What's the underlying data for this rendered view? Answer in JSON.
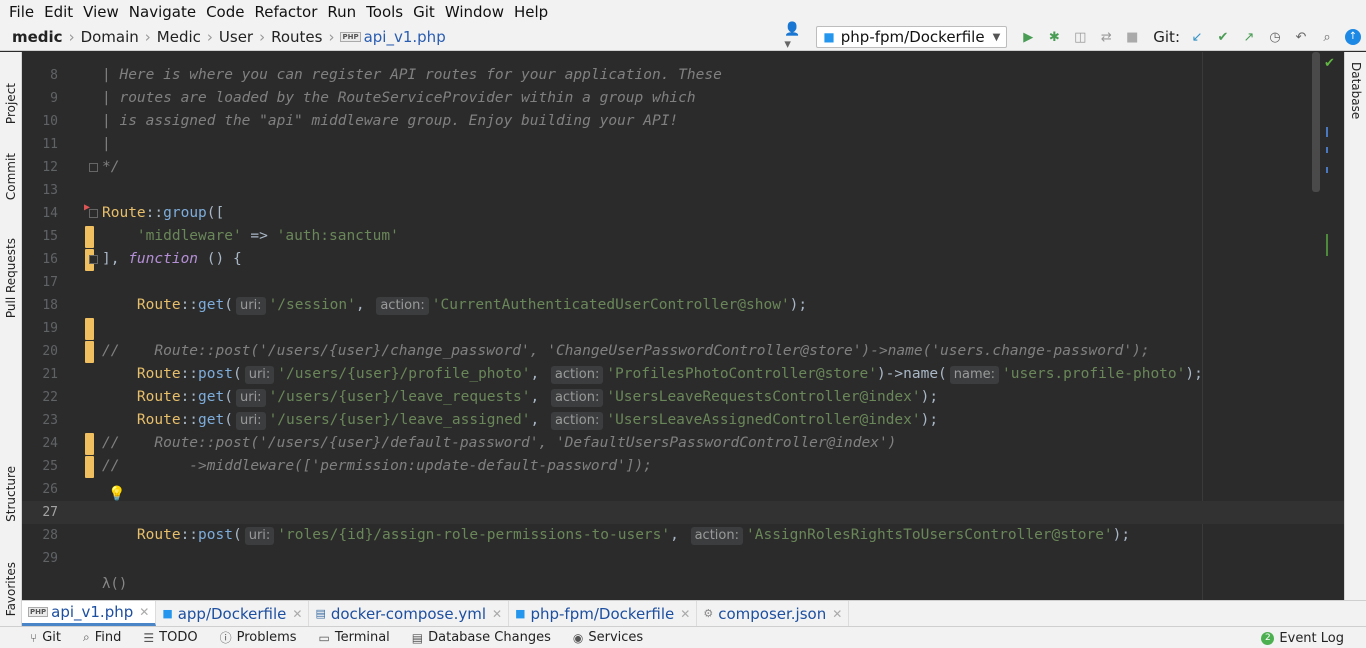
{
  "menu": [
    "File",
    "Edit",
    "View",
    "Navigate",
    "Code",
    "Refactor",
    "Run",
    "Tools",
    "Git",
    "Window",
    "Help"
  ],
  "breadcrumb": {
    "project": "medic",
    "items": [
      "Domain",
      "Medic",
      "User",
      "Routes"
    ],
    "file": "api_v1.php",
    "file_type": "PHP"
  },
  "toolbar": {
    "run_config": "php-fpm/Dockerfile",
    "git_label": "Git:"
  },
  "left_tabs": {
    "project": "Project",
    "commit": "Commit",
    "pull_requests": "Pull Requests",
    "structure": "Structure",
    "favorites": "Favorites"
  },
  "right_tabs": {
    "database": "Database"
  },
  "editor": {
    "lines": [
      {
        "n": "8",
        "t": "| Here is where you can register API routes for your application. These"
      },
      {
        "n": "9",
        "t": "| routes are loaded by the RouteServiceProvider within a group which"
      },
      {
        "n": "10",
        "t": "| is assigned the \"api\" middleware group. Enjoy building your API!"
      },
      {
        "n": "11",
        "t": "|"
      },
      {
        "n": "12",
        "t": "*/"
      },
      {
        "n": "13"
      },
      {
        "n": "14"
      },
      {
        "n": "15"
      },
      {
        "n": "16"
      },
      {
        "n": "17"
      },
      {
        "n": "18"
      },
      {
        "n": "19"
      },
      {
        "n": "20",
        "t": "//    Route::post('/users/{user}/change_password', 'ChangeUserPasswordController@store')->name('users.change-password');"
      },
      {
        "n": "21"
      },
      {
        "n": "22"
      },
      {
        "n": "23"
      },
      {
        "n": "24",
        "t": "//    Route::post('/users/{user}/default-password', 'DefaultUsersPasswordController@index')"
      },
      {
        "n": "25",
        "t": "//        ->middleware(['permission:update-default-password']);"
      },
      {
        "n": "26"
      },
      {
        "n": "27"
      },
      {
        "n": "28"
      },
      {
        "n": "29"
      }
    ],
    "tokens": {
      "route": "Route",
      "dc": "::",
      "group": "group",
      "open_group": "([",
      "middleware_key": "'middleware'",
      "arrow": " => ",
      "auth": "'auth:sanctum'",
      "close": "], ",
      "function": "function",
      "fn_rest": " () {",
      "get": "get",
      "post": "post",
      "paren": "(",
      "uri_hint": "uri:",
      "action_hint": "action:",
      "name_hint": "name:",
      "session_uri": "'/session'",
      "session_action": "'CurrentAuthenticatedUserController@show'",
      "photo_uri": "'/users/{user}/profile_photo'",
      "photo_action": "'ProfilesPhotoController@store'",
      "name_call": ")->name(",
      "photo_name": "'users.profile-photo'",
      "lreq_uri": "'/users/{user}/leave_requests'",
      "lreq_action": "'UsersLeaveRequestsController@index'",
      "lasg_uri": "'/users/{user}/leave_assigned'",
      "lasg_action": "'UsersLeaveAssignedController@index'",
      "roles_uri": "'roles/{id}/assign-role-permissions-to-users'",
      "roles_action": "'AssignRolesRightsToUsersController@store'",
      "end": ");",
      "comma": ", "
    },
    "lambda": "λ()"
  },
  "tabs": [
    {
      "label": "api_v1.php",
      "active": true
    },
    {
      "label": "app/Dockerfile"
    },
    {
      "label": "docker-compose.yml"
    },
    {
      "label": "php-fpm/Dockerfile"
    },
    {
      "label": "composer.json"
    }
  ],
  "status": {
    "git": "Git",
    "find": "Find",
    "todo": "TODO",
    "problems": "Problems",
    "terminal": "Terminal",
    "db_changes": "Database Changes",
    "services": "Services",
    "event_log": "Event Log",
    "event_count": "2"
  },
  "colors": {
    "comment": "#808080",
    "class": "#e8bf6a",
    "string": "#6a8759",
    "method": "#7eaddb",
    "keyword": "#b58fd6",
    "change_marker": "#f0c060"
  }
}
